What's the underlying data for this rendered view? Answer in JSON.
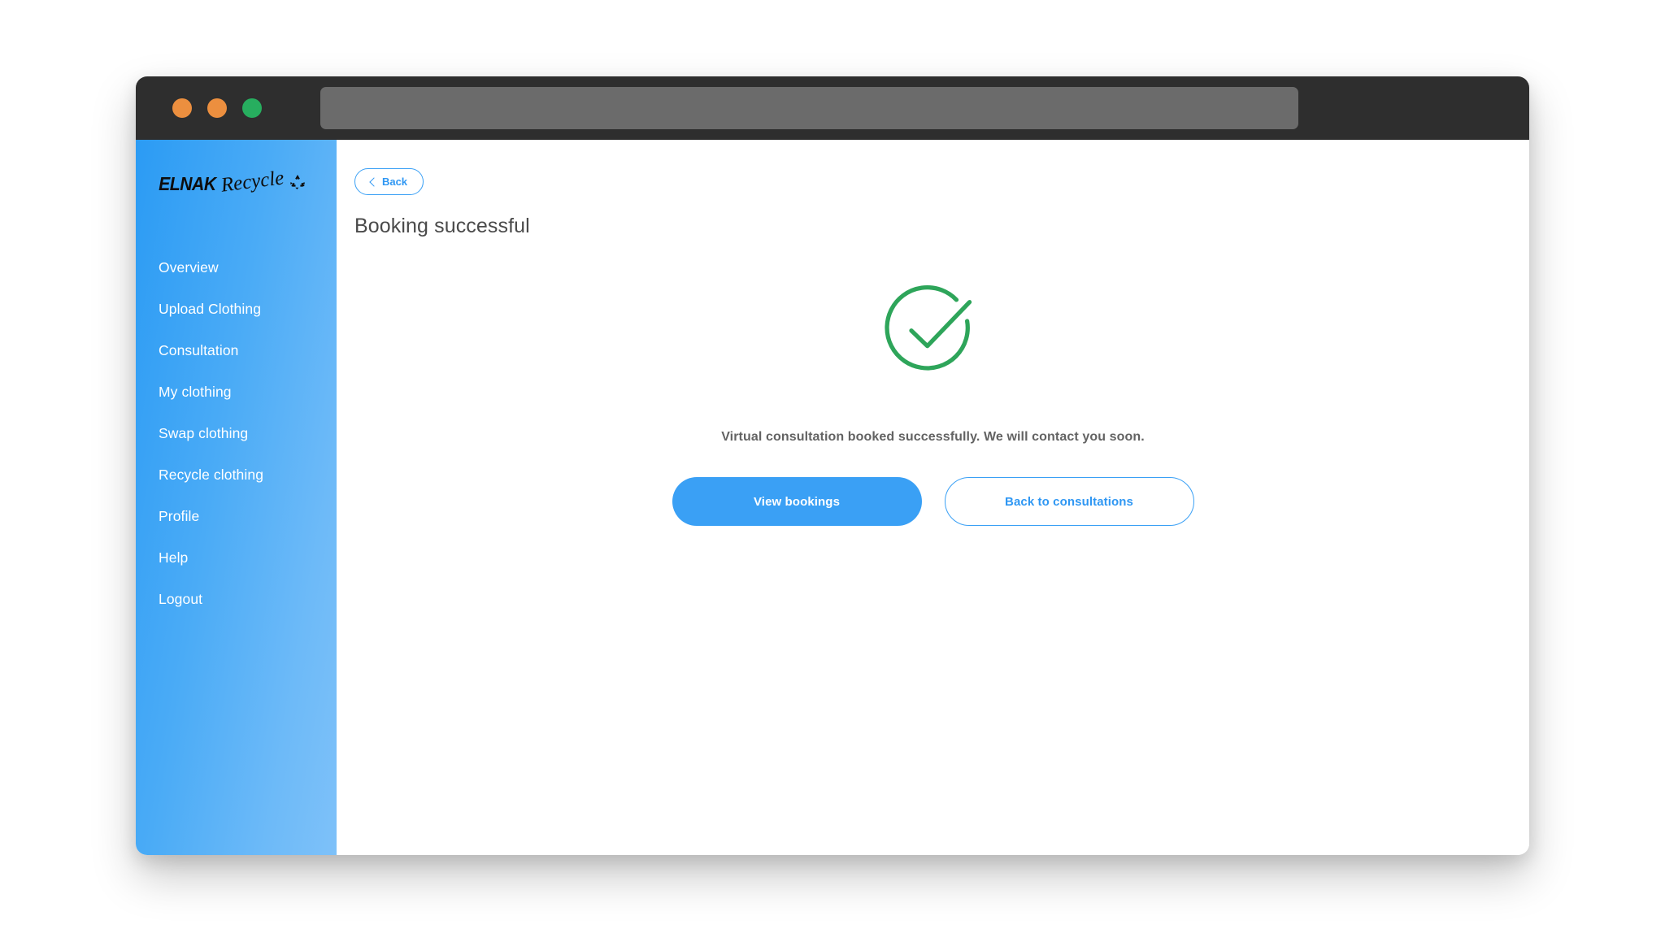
{
  "window": {
    "traffic_lights": [
      {
        "name": "close",
        "color": "#ec8f3f"
      },
      {
        "name": "minimize",
        "color": "#ec8f3f"
      },
      {
        "name": "maximize",
        "color": "#27ae5f"
      }
    ],
    "url_bar": {
      "value": "",
      "placeholder": ""
    }
  },
  "sidebar": {
    "logo": {
      "brand": "ELNAK",
      "word": "Recycle",
      "mark": "recycle-symbol"
    },
    "items": [
      {
        "label": "Overview"
      },
      {
        "label": "Upload Clothing"
      },
      {
        "label": "Consultation"
      },
      {
        "label": "My clothing"
      },
      {
        "label": "Swap clothing"
      },
      {
        "label": "Recycle clothing"
      },
      {
        "label": "Profile"
      },
      {
        "label": "Help"
      },
      {
        "label": "Logout"
      }
    ],
    "gradient_from": "#2b9bf4",
    "gradient_to": "#7ec1f9"
  },
  "content": {
    "back_label": "Back",
    "title": "Booking successful",
    "success_icon": "check-circle-icon",
    "success_color": "#2ea55a",
    "message": "Virtual consultation booked successfully. We will contact you soon.",
    "primary_button": "View bookings",
    "secondary_button": "Back to consultations",
    "accent_color": "#3aa0f5"
  }
}
